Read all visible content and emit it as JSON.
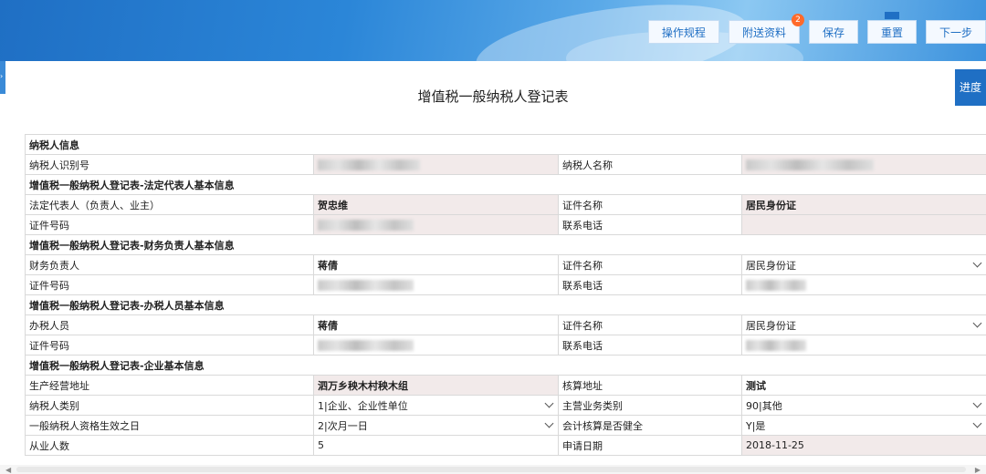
{
  "toolbar": {
    "buttons": [
      {
        "label": "操作规程"
      },
      {
        "label": "附送资料",
        "badge": "2"
      },
      {
        "label": "保存"
      },
      {
        "label": "重置"
      },
      {
        "label": "下一步"
      }
    ]
  },
  "progress_label": "进度",
  "page_title": "增值税一般纳税人登记表",
  "form": {
    "taxpayer_section": "纳税人信息",
    "taxpayer_id_label": "纳税人识别号",
    "taxpayer_name_label": "纳税人名称",
    "legal_section": "增值税一般纳税人登记表-法定代表人基本信息",
    "legal_person_label": "法定代表人（负责人、业主）",
    "legal_person_value": "贺忠维",
    "legal_cert_name_label": "证件名称",
    "legal_cert_name_value": "居民身份证",
    "legal_cert_no_label": "证件号码",
    "legal_phone_label": "联系电话",
    "finance_section": "增值税一般纳税人登记表-财务负责人基本信息",
    "finance_person_label": "财务负责人",
    "finance_person_value": "蒋倩",
    "finance_cert_name_label": "证件名称",
    "finance_cert_name_value": "居民身份证",
    "finance_cert_no_label": "证件号码",
    "finance_phone_label": "联系电话",
    "handler_section": "增值税一般纳税人登记表-办税人员基本信息",
    "handler_person_label": "办税人员",
    "handler_person_value": "蒋倩",
    "handler_cert_name_label": "证件名称",
    "handler_cert_name_value": "居民身份证",
    "handler_cert_no_label": "证件号码",
    "handler_phone_label": "联系电话",
    "enterprise_section": "增值税一般纳税人登记表-企业基本信息",
    "address_label": "生产经营地址",
    "address_value": "泗万乡秧木村秧木组",
    "accounting_address_label": "核算地址",
    "accounting_address_value": "测试",
    "taxpayer_type_label": "纳税人类别",
    "taxpayer_type_value": "1|企业、企业性单位",
    "main_business_label": "主营业务类别",
    "main_business_value": "90|其他",
    "effective_date_label": "一般纳税人资格生效之日",
    "effective_date_value": "2|次月一日",
    "accounting_sound_label": "会计核算是否健全",
    "accounting_sound_value": "Y|是",
    "employees_label": "从业人数",
    "employees_value": "5",
    "apply_date_label": "申请日期",
    "apply_date_value": "2018-11-25"
  }
}
